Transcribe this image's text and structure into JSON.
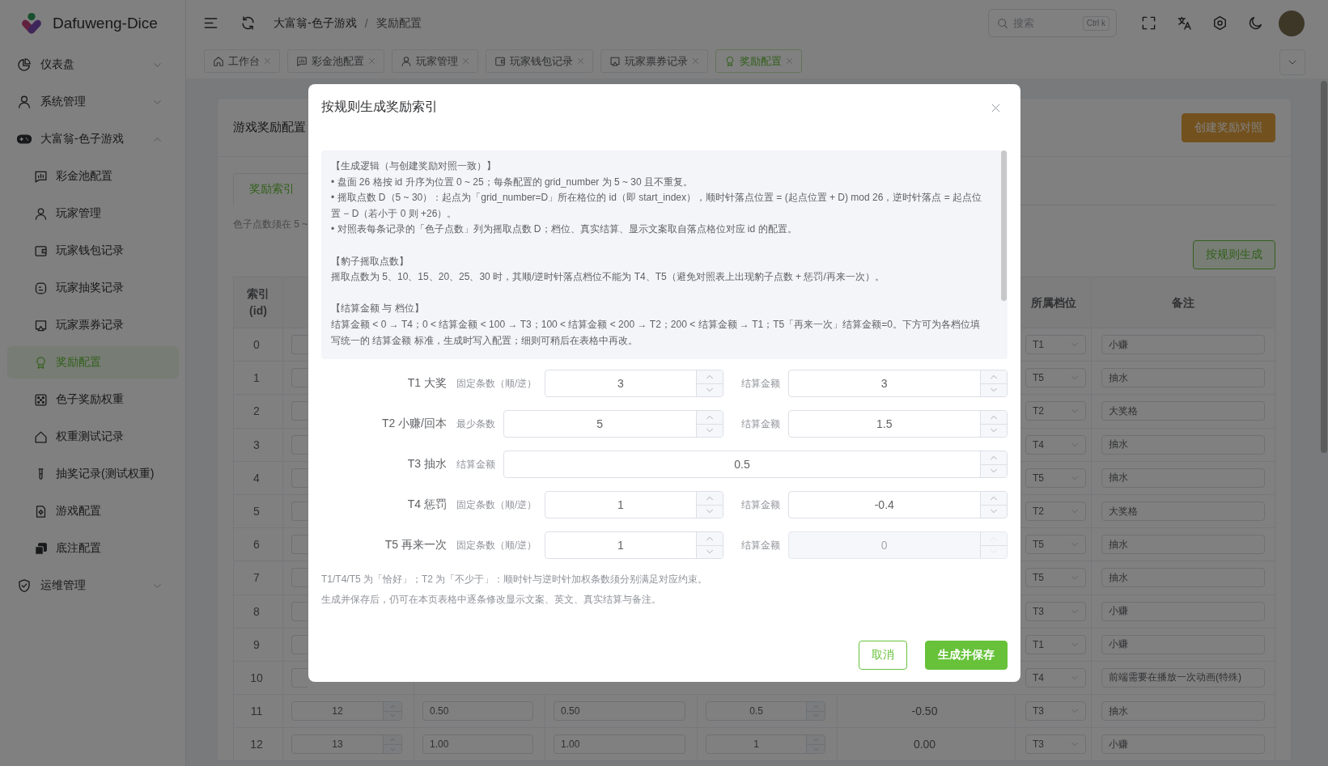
{
  "sidebar": {
    "brand": "Dafuweng-Dice",
    "items": [
      {
        "label": "仪表盘",
        "expanded": false
      },
      {
        "label": "系统管理",
        "expanded": false
      },
      {
        "label": "大富翁-色子游戏",
        "expanded": true,
        "children": [
          {
            "label": "彩金池配置",
            "selected": false
          },
          {
            "label": "玩家管理",
            "selected": false
          },
          {
            "label": "玩家钱包记录",
            "selected": false
          },
          {
            "label": "玩家抽奖记录",
            "selected": false
          },
          {
            "label": "玩家票券记录",
            "selected": false
          },
          {
            "label": "奖励配置",
            "selected": true
          },
          {
            "label": "色子奖励权重",
            "selected": false
          },
          {
            "label": "权重测试记录",
            "selected": false
          },
          {
            "label": "抽奖记录(测试权重)",
            "selected": false
          },
          {
            "label": "游戏配置",
            "selected": false
          },
          {
            "label": "底注配置",
            "selected": false
          }
        ]
      },
      {
        "label": "运维管理",
        "expanded": false
      }
    ]
  },
  "header": {
    "breadcrumb": {
      "items": [
        "大富翁-色子游戏",
        "奖励配置"
      ],
      "separator": "/"
    },
    "search": {
      "placeholder": "搜索",
      "shortcut": "Ctrl k"
    }
  },
  "tabs": [
    {
      "label": "工作台",
      "selected": false
    },
    {
      "label": "彩金池配置",
      "selected": false
    },
    {
      "label": "玩家管理",
      "selected": false
    },
    {
      "label": "玩家钱包记录",
      "selected": false
    },
    {
      "label": "玩家票券记录",
      "selected": false
    },
    {
      "label": "奖励配置",
      "selected": true
    }
  ],
  "page": {
    "title": "游戏奖励配置",
    "create_button": "创建奖励对照",
    "tabs": [
      {
        "label": "奖励索引",
        "selected": true
      }
    ],
    "hint": "色子点数须在 5 ~",
    "generate_button": "按规则生成",
    "table": {
      "columns": {
        "index": "索引 (id)",
        "tier": "所属档位",
        "note": "备注"
      },
      "rows": [
        {
          "index": "0",
          "tier": "T1",
          "note": "小赚"
        },
        {
          "index": "1",
          "tier": "T5",
          "note": "抽水"
        },
        {
          "index": "2",
          "tier": "T2",
          "note": "大奖格"
        },
        {
          "index": "3",
          "tier": "T4",
          "note": "抽水"
        },
        {
          "index": "4",
          "tier": "T5",
          "note": "抽水"
        },
        {
          "index": "5",
          "tier": "T2",
          "note": "大奖格"
        },
        {
          "index": "6",
          "tier": "T5",
          "note": "抽水"
        },
        {
          "index": "7",
          "tier": "T5",
          "note": "抽水"
        },
        {
          "index": "8",
          "tier": "T3",
          "note": "小赚"
        },
        {
          "index": "9",
          "tier": "T1",
          "note": "小赚"
        },
        {
          "index": "10",
          "tier": "T4",
          "note": "前端需要在播放一次动画(特殊)"
        },
        {
          "index": "11",
          "column_2": "12",
          "column_3": "0.50",
          "column_4": "0.50",
          "column_5": "0.5",
          "column_6": "-0.50",
          "tier": "T3",
          "note": "抽水"
        },
        {
          "index": "12",
          "column_2": "13",
          "column_3": "1.00",
          "column_4": "1.00",
          "column_5": "1",
          "column_6": "0.00",
          "tier": "T3",
          "note": "小赚"
        }
      ]
    }
  },
  "modal": {
    "title": "按规则生成奖励索引",
    "info": {
      "sections": [
        {
          "heading": "【生成逻辑（与创建奖励对照一致）】",
          "lines": [
            "• 盘面 26 格按 id 升序为位置 0 ~ 25；每条配置的 grid_number 为 5 ~ 30 且不重复。",
            "• 摇取点数 D（5 ~ 30）：起点为「grid_number=D」所在格位的 id（即 start_index），顺时针落点位置 = (起点位置 + D) mod 26，逆时针落点 = 起点位置 − D（若小于 0 则 +26）。",
            "• 对照表每条记录的「色子点数」列为摇取点数 D；档位、真实结算、显示文案取自落点格位对应 id 的配置。"
          ]
        },
        {
          "heading": "【豹子摇取点数】",
          "lines": [
            "摇取点数为 5、10、15、20、25、30 时，其顺/逆时针落点档位不能为 T4、T5（避免对照表上出现豹子点数 + 惩罚/再来一次）。"
          ]
        },
        {
          "heading": "【结算金额 与 档位】",
          "lines": [
            "结算金额 < 0 → T4；0 < 结算金额 < 100 → T3；100 < 结算金额 < 200 → T2；200 < 结算金额 → T1；T5「再来一次」结算金额=0。下方可为各档位填写统一的 结算金额 标准，生成时写入配置；细则可稍后在表格中再改。"
          ]
        }
      ]
    },
    "form": {
      "rows": [
        {
          "label": "T1 大奖",
          "fields": [
            {
              "label": "固定条数（顺/逆）",
              "value": "3",
              "disabled": false
            },
            {
              "label": "结算金额",
              "value": "3",
              "disabled": false
            }
          ]
        },
        {
          "label": "T2 小赚/回本",
          "fields": [
            {
              "label": "最少条数",
              "value": "5",
              "disabled": false
            },
            {
              "label": "结算金额",
              "value": "1.5",
              "disabled": false
            }
          ]
        },
        {
          "label": "T3 抽水",
          "fields": [
            {
              "label": "结算金额",
              "value": "0.5",
              "disabled": false
            }
          ]
        },
        {
          "label": "T4 惩罚",
          "fields": [
            {
              "label": "固定条数（顺/逆）",
              "value": "1",
              "disabled": false
            },
            {
              "label": "结算金额",
              "value": "-0.4",
              "disabled": false
            }
          ]
        },
        {
          "label": "T5 再来一次",
          "fields": [
            {
              "label": "固定条数（顺/逆）",
              "value": "1",
              "disabled": false
            },
            {
              "label": "结算金额",
              "value": "0",
              "disabled": true
            }
          ]
        }
      ]
    },
    "notes": [
      "T1/T4/T5 为「恰好」；T2 为「不少于」：顺时针与逆时针加权条数须分别满足对应约束。",
      "生成并保存后，仍可在本页表格中逐条修改显示文案、英文、真实结算与备注。"
    ],
    "buttons": [
      {
        "label": "取消",
        "kind": "outline"
      },
      {
        "label": "生成并保存",
        "kind": "solid"
      }
    ]
  }
}
